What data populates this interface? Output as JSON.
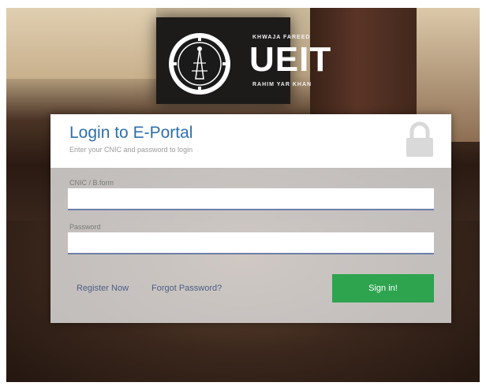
{
  "logo": {
    "top_text": "KHWAJA FAREED",
    "main_text": "UEIT",
    "bottom_text": "RAHIM YAR KHAN",
    "emblem_icon": "university-emblem-icon"
  },
  "login": {
    "title": "Login to E-Portal",
    "subtitle": "Enter your CNIC and password to login",
    "lock_icon": "lock-icon",
    "cnic_label": "CNIC / B.form",
    "cnic_value": "",
    "password_label": "Password",
    "password_value": "",
    "register_link": "Register Now",
    "forgot_link": "Forgot Password?",
    "signin_button": "Sign in!"
  },
  "colors": {
    "title": "#2f6fab",
    "signin": "#2ea44f",
    "field_underline": "#6d7fa8"
  }
}
